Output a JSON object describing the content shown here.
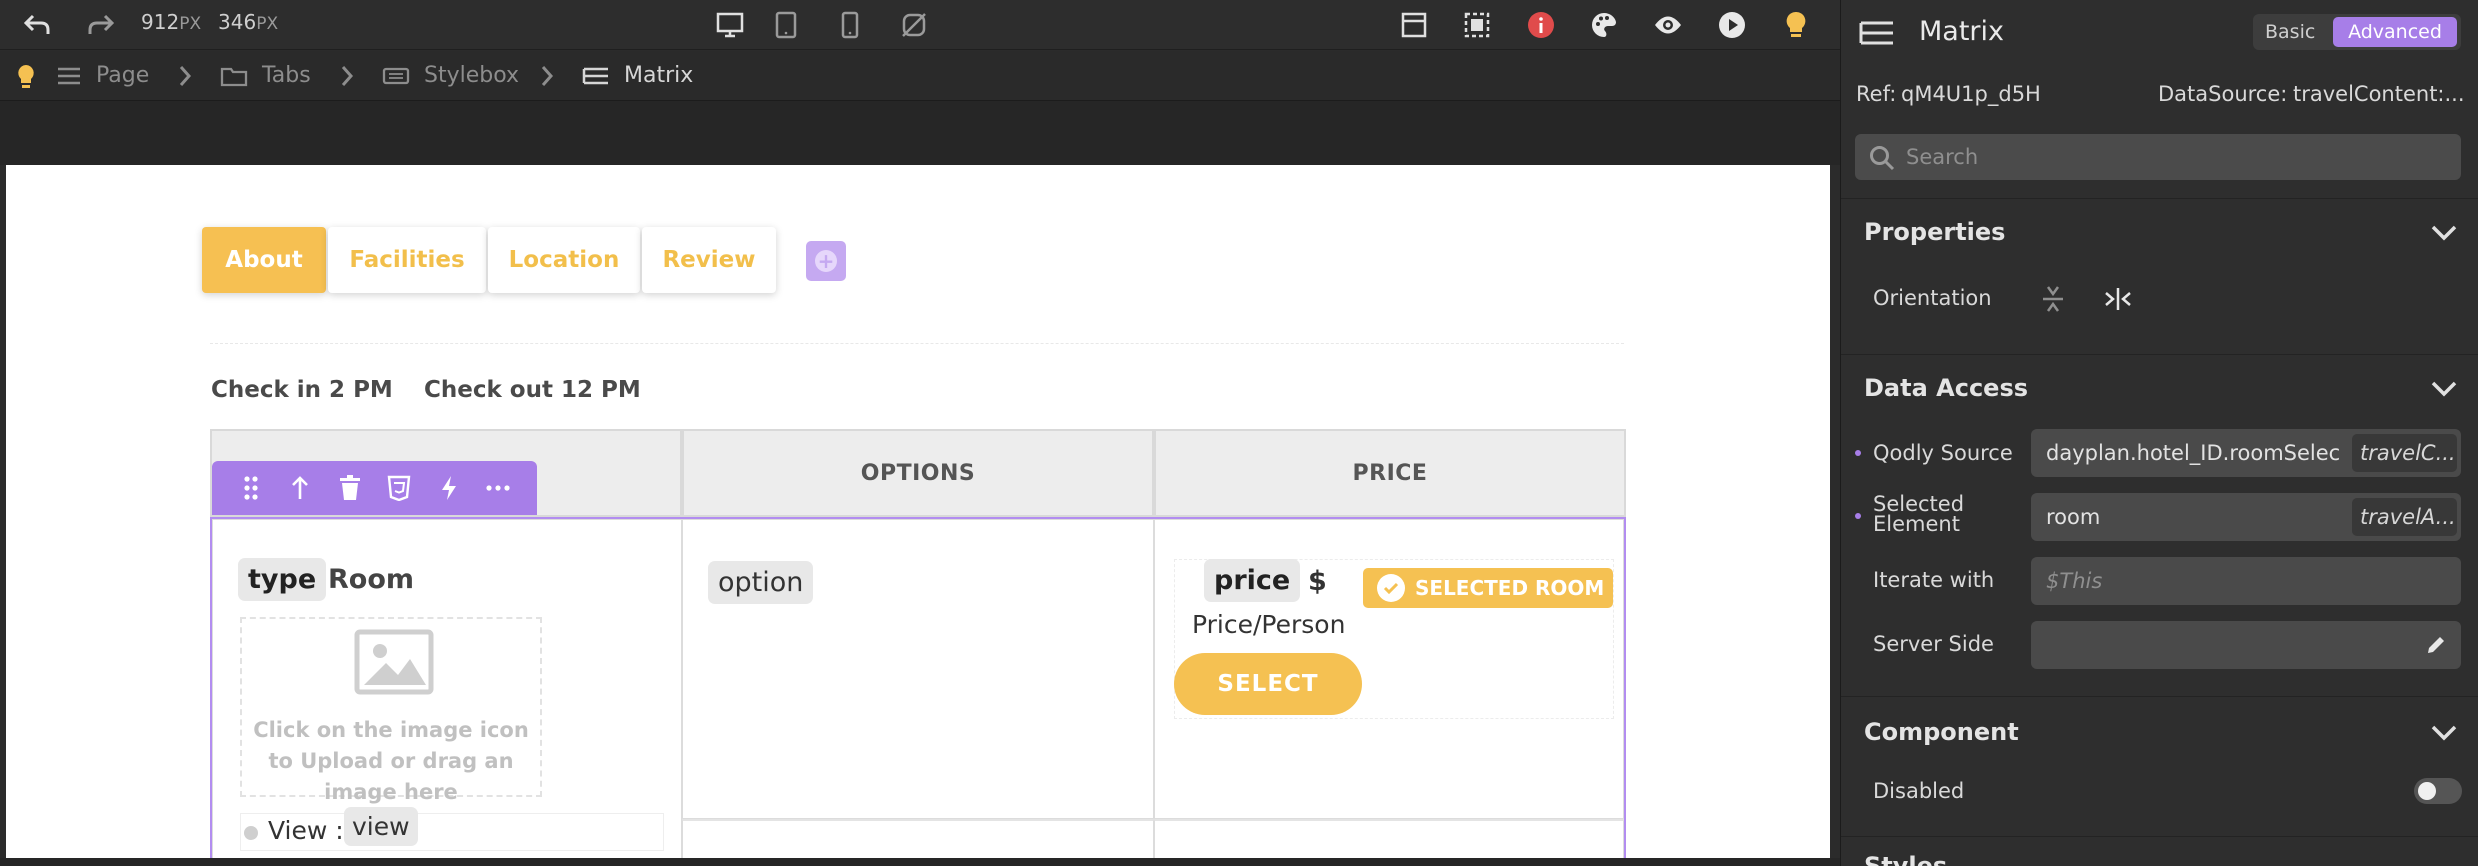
{
  "toolbar": {
    "width_value": "912",
    "width_unit": "PX",
    "height_value": "346",
    "height_unit": "PX",
    "icons": [
      "undo-icon",
      "redo-icon",
      "desktop-icon",
      "tablet-icon",
      "mobile-icon",
      "no-device-icon",
      "layout-icon",
      "select-icon",
      "info-icon",
      "palette-icon",
      "preview-icon",
      "run-icon",
      "tips-icon"
    ],
    "colors": {
      "info": "#e04b4b",
      "tips": "#f5c152"
    }
  },
  "breadcrumb": [
    {
      "label": "Page",
      "icon": "page-icon"
    },
    {
      "label": "Tabs",
      "icon": "folder-icon"
    },
    {
      "label": "Stylebox",
      "icon": "stylebox-icon"
    },
    {
      "label": "Matrix",
      "icon": "matrix-icon"
    }
  ],
  "canvas": {
    "tabs": [
      {
        "label": "About",
        "active": true
      },
      {
        "label": "Facilities",
        "active": false
      },
      {
        "label": "Location",
        "active": false
      },
      {
        "label": "Review",
        "active": false
      }
    ],
    "check_in": "Check in 2 PM",
    "check_out": "Check out 12 PM",
    "table": {
      "headers": [
        "",
        "OPTIONS",
        "PRICE"
      ],
      "row": {
        "type_chip": "type",
        "type_text": "Room",
        "image_caption": "Click on the image icon to Upload or drag an image here",
        "view_label": "View :",
        "view_chip": "view",
        "option_chip": "option",
        "price_chip": "price",
        "currency": "$",
        "price_per": "Price/Person",
        "selected_badge": "SELECTED ROOM",
        "select_button": "SELECT"
      }
    },
    "colors": {
      "accent": "#f5c152",
      "selection": "#a77ee8"
    }
  },
  "panel": {
    "title": "Matrix",
    "mode_basic": "Basic",
    "mode_advanced": "Advanced",
    "ref_label": "Ref:",
    "ref_value": "qM4U1p_d5H",
    "datasource_label": "DataSource:",
    "datasource_value": "travelContent:...",
    "search_placeholder": "Search",
    "sections": {
      "properties": "Properties",
      "data_access": "Data Access",
      "component": "Component",
      "next": "Styles"
    },
    "orientation_label": "Orientation",
    "qodly_source_label": "Qodly Source",
    "qodly_source_value": "dayplan.hotel_ID.roomSelec",
    "qodly_source_tag": "travelC...",
    "selected_element_label_1": "Selected",
    "selected_element_label_2": "Element",
    "selected_element_value": "room",
    "selected_element_tag": "travelA...",
    "iterate_label": "Iterate with",
    "iterate_placeholder": "$This",
    "server_side_label": "Server Side",
    "disabled_label": "Disabled",
    "disabled": false
  }
}
